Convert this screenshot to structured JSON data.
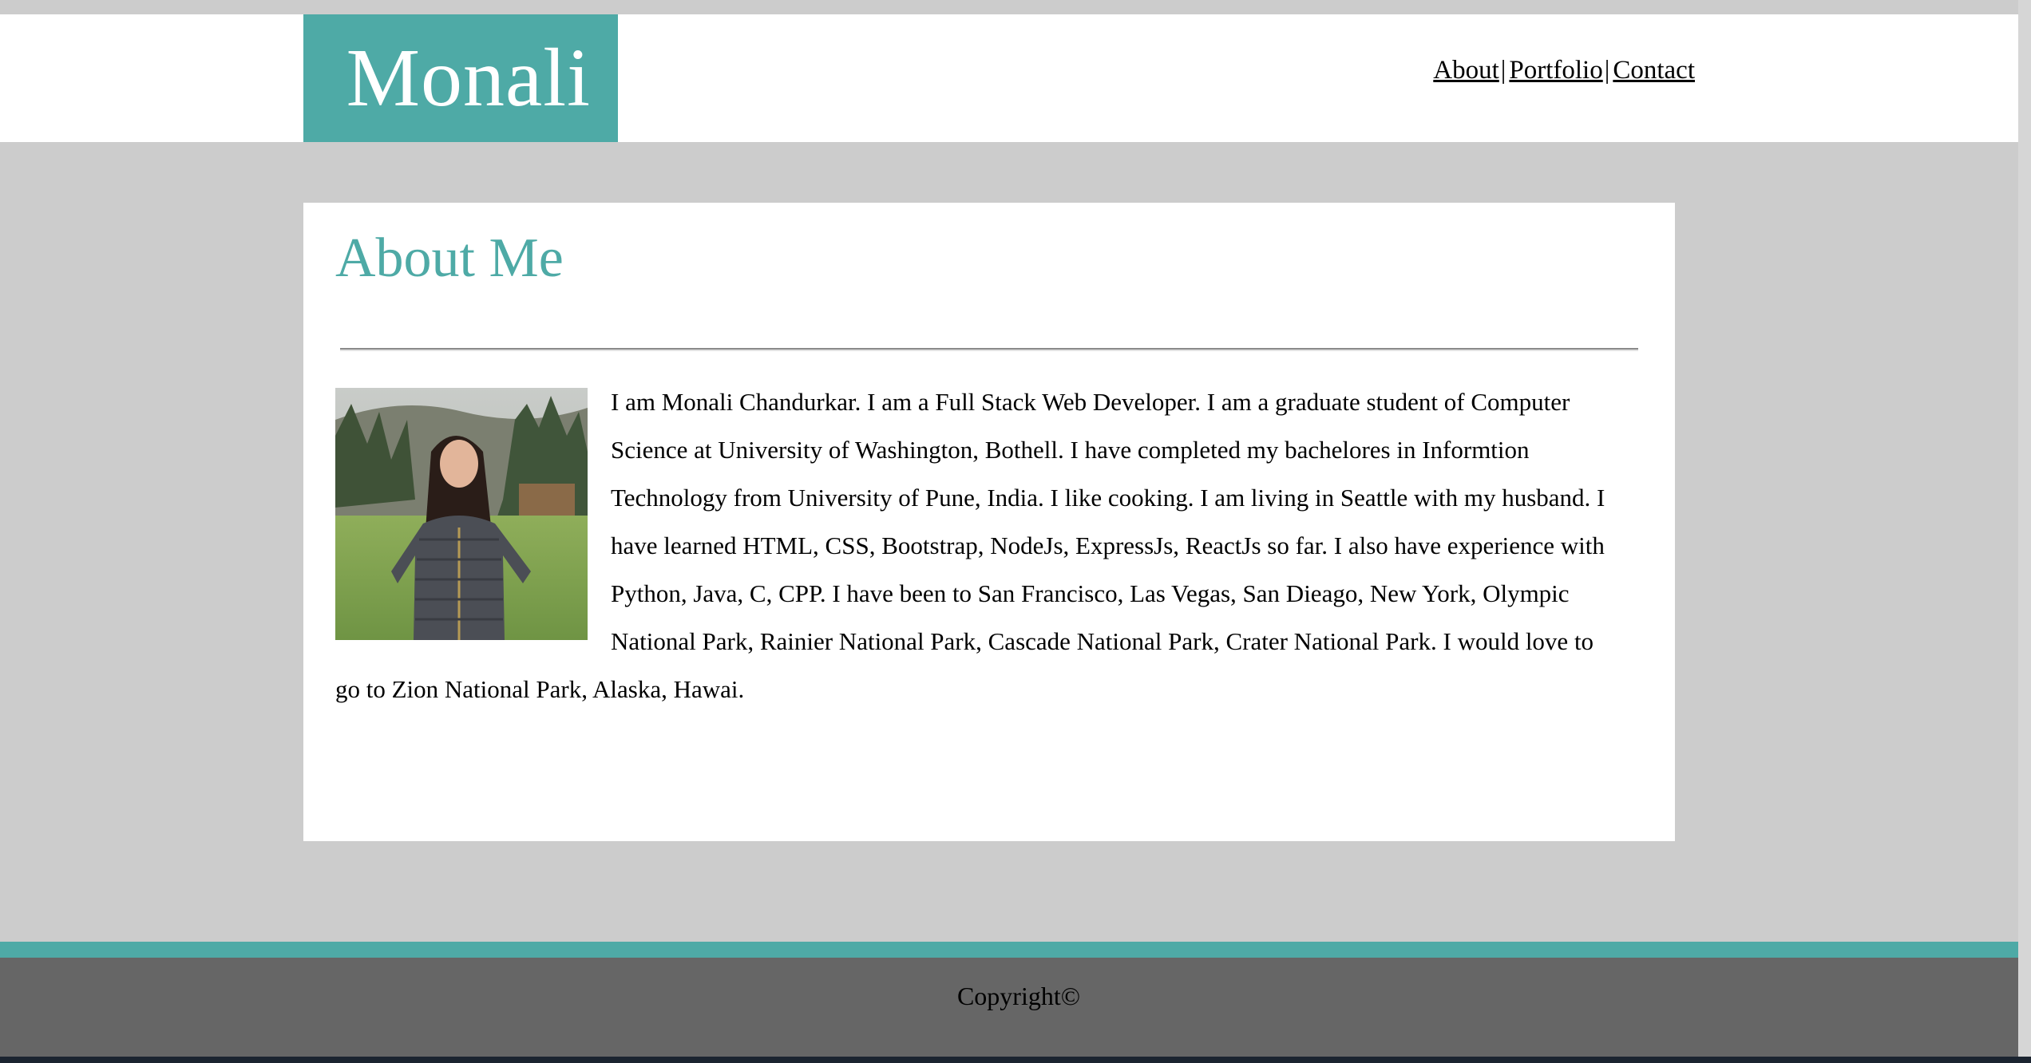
{
  "header": {
    "brand": "Monali",
    "nav": {
      "about": "About",
      "portfolio": "Portfolio",
      "contact": "Contact",
      "separator": "|"
    }
  },
  "about": {
    "title": "About Me",
    "body": "I am Monali Chandurkar. I am a Full Stack Web Developer. I am a graduate student of Computer Science at University of Washington, Bothell. I have completed my bachelores in Informtion Technology from University of Pune, India. I like cooking. I am living in Seattle with my husband. I have learned HTML, CSS, Bootstrap, NodeJs, ExpressJs, ReactJs so far. I also have experience with Python, Java, C, CPP. I have been to San Francisco, Las Vegas, San Dieago, New York, Olympic National Park, Rainier National Park, Cascade National Park, Crater National Park. I would love to go to Zion National Park, Alaska, Hawai."
  },
  "footer": {
    "copyright": "Copyright©"
  },
  "colors": {
    "accent": "#4eaaa6",
    "page_background": "#cccccc",
    "footer_background": "#666666"
  }
}
